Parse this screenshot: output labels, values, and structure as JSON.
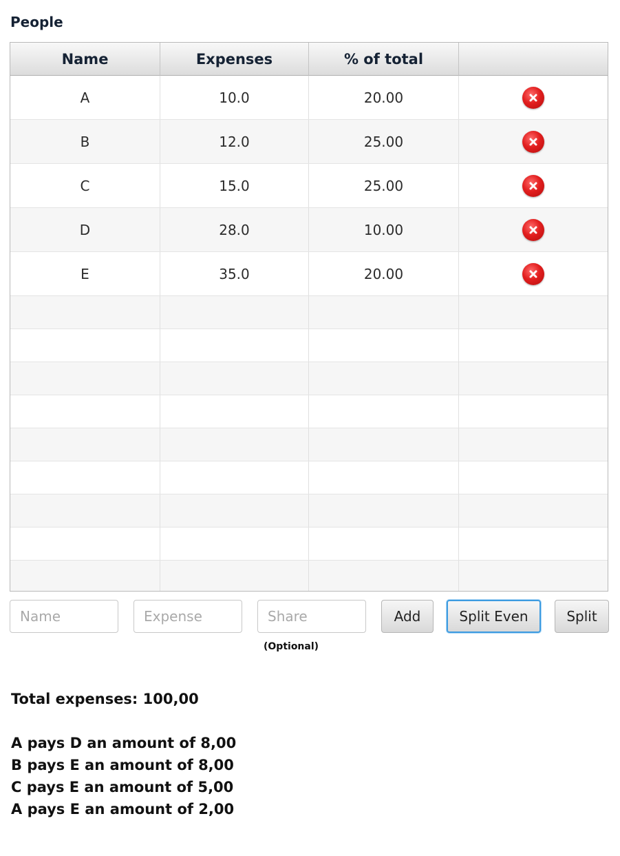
{
  "section_title": "People",
  "table": {
    "headers": [
      "Name",
      "Expenses",
      "% of total",
      ""
    ],
    "rows": [
      {
        "name": "A",
        "expenses": "10.0",
        "percent": "20.00"
      },
      {
        "name": "B",
        "expenses": "12.0",
        "percent": "25.00"
      },
      {
        "name": "C",
        "expenses": "15.0",
        "percent": "25.00"
      },
      {
        "name": "D",
        "expenses": "28.0",
        "percent": "10.00"
      },
      {
        "name": "E",
        "expenses": "35.0",
        "percent": "20.00"
      }
    ],
    "row_icon": "delete-icon",
    "empty_rows": 9
  },
  "form": {
    "name_placeholder": "Name",
    "expense_placeholder": "Expense",
    "share_placeholder": "Share",
    "share_hint": "(Optional)",
    "add_label": "Add",
    "split_even_label": "Split Even",
    "split_label": "Split"
  },
  "summary": {
    "total": "Total expenses: 100,00",
    "payments": [
      "A pays D an amount of 8,00",
      "B pays E an amount of 8,00",
      "C pays E an amount of 5,00",
      "A pays E an amount of 2,00"
    ]
  },
  "colors": {
    "accent_focus": "#3d9be0",
    "delete_red": "#e21f1f"
  }
}
